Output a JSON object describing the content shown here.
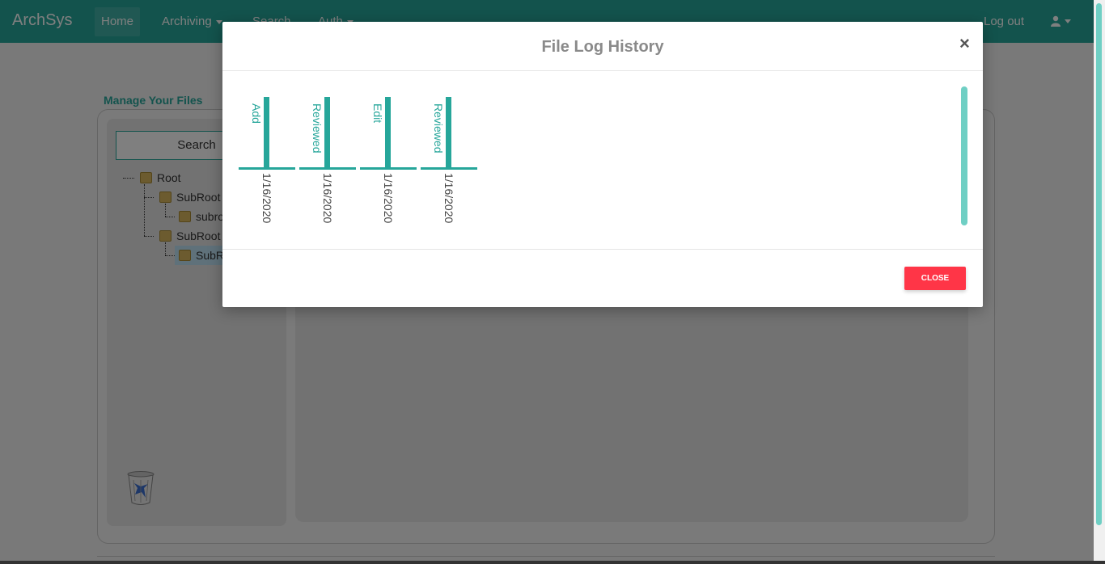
{
  "navbar": {
    "brand": "ArchSys",
    "items": [
      {
        "label": "Home"
      },
      {
        "label": "Archiving"
      },
      {
        "label": "Search"
      },
      {
        "label": "Auth"
      }
    ],
    "logout": "Log out"
  },
  "page": {
    "title": "Manage Your Files",
    "search_label": "Search",
    "tree": [
      {
        "label": "Root"
      },
      {
        "label": "SubRoot"
      },
      {
        "label": "subro"
      },
      {
        "label": "SubRoot"
      },
      {
        "label": "SubR"
      }
    ]
  },
  "modal": {
    "title": "File Log History",
    "close_symbol": "×",
    "close_button": "CLOSE",
    "entries": [
      {
        "action": "Add",
        "date": "1/16/2020"
      },
      {
        "action": "Reviewed",
        "date": "1/16/2020"
      },
      {
        "action": "Edit",
        "date": "1/16/2020"
      },
      {
        "action": "Reviewed",
        "date": "1/16/2020"
      }
    ]
  },
  "colors": {
    "primary": "#26a69a",
    "danger": "#ff3547"
  }
}
